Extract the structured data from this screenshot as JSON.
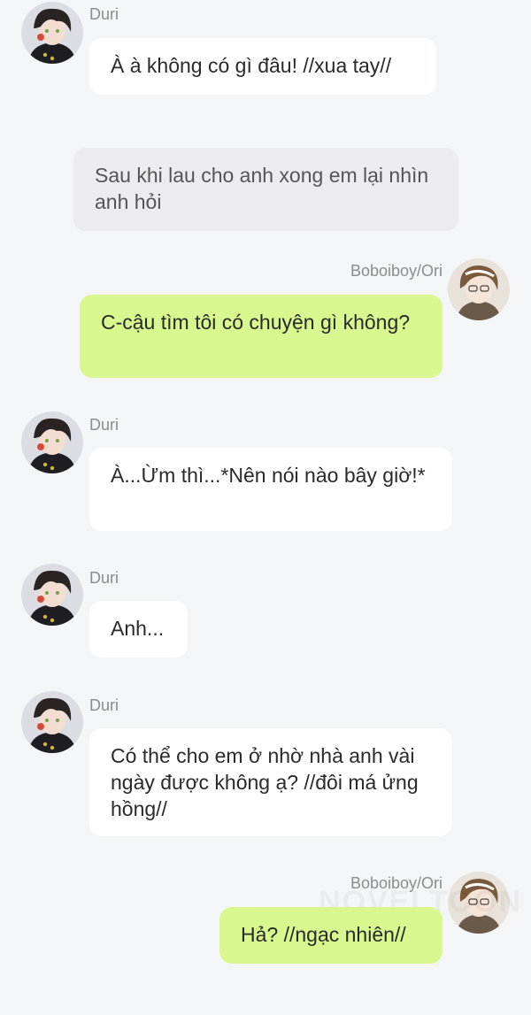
{
  "messages": [
    {
      "sender": "Duri",
      "text": "À à không có gì đâu! //xua tay//"
    },
    {
      "narration": "Sau khi lau cho anh xong em lại nhìn anh hỏi"
    },
    {
      "sender": "Boboiboy/Ori",
      "text": "C-cậu tìm tôi có chuyện gì không?"
    },
    {
      "sender": "Duri",
      "text": "À...Ừm thì...*Nên nói nào bây giờ!*"
    },
    {
      "sender": "Duri",
      "text": "Anh..."
    },
    {
      "sender": "Duri",
      "text": "Có thể cho em ở nhờ nhà anh vài ngày được không ạ? //đôi má ửng hồng//"
    },
    {
      "sender": "Boboiboy/Ori",
      "text": "Hả? //ngạc nhiên//"
    }
  ],
  "watermark": "NOVELTOON",
  "colors": {
    "background": "#f4f5f7",
    "bubble_left": "#ffffff",
    "bubble_right": "#d8f78f",
    "narration": "#ececef"
  },
  "icons": {
    "duri_avatar": "duri-avatar-icon",
    "ori_avatar": "ori-avatar-icon"
  }
}
